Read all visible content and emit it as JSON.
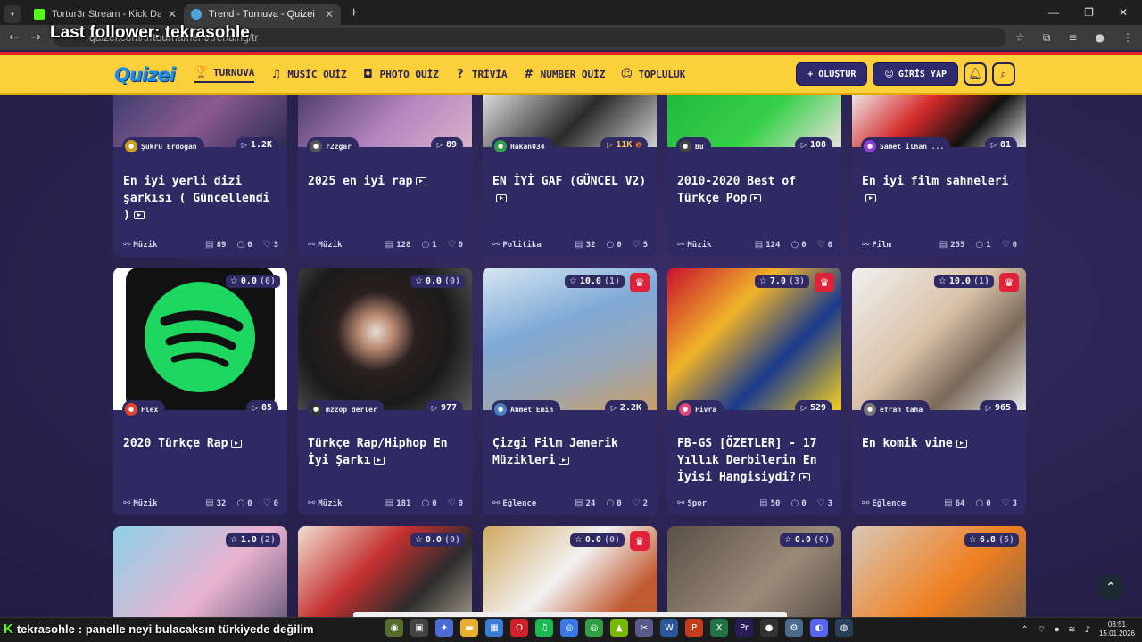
{
  "browser": {
    "tabs": [
      {
        "title": "Tortur3r Stream - Kick Dashbo...",
        "favicon_color": "#53fc18",
        "active": false
      },
      {
        "title": "Trend - Turnuva - Quizei",
        "favicon_color": "#4fa3e0",
        "active": true
      }
    ],
    "new_tab": "+",
    "url": "quizei.com/tr/tournament/trending/tr",
    "overlay_follower": "Last follower: tekrasohle"
  },
  "site": {
    "logo": "Quizei",
    "nav": [
      {
        "label": "TURNUVA",
        "icon": "trophy-icon",
        "glyph": "🏆",
        "active": true
      },
      {
        "label": "MUSİC QUİZ",
        "icon": "music-icon",
        "glyph": "♫",
        "active": false
      },
      {
        "label": "PHOTO QUİZ",
        "icon": "camera-icon",
        "glyph": "◘",
        "active": false
      },
      {
        "label": "TRİVİA",
        "icon": "speech-bubble-icon",
        "glyph": "?",
        "active": false
      },
      {
        "label": "NUMBER QUİZ",
        "icon": "hash-icon",
        "glyph": "#",
        "active": false
      },
      {
        "label": "TOPLULUK",
        "icon": "users-icon",
        "glyph": "☺",
        "active": false
      }
    ],
    "create_label": "+ OLUŞTUR",
    "login_label": "GİRİŞ YAP",
    "accent": "#fbd03b",
    "brand_red": "#e8202a",
    "card_bg": "#2f2a63"
  },
  "cards_top": [
    {
      "author": "Şükrü Erdoğan",
      "avatar_color": "#c9a020",
      "plays": "1.2K",
      "title": "En iyi yerli dizi şarkısı ( Güncellendi )",
      "category": "Müzik",
      "count": "89",
      "comments": "0",
      "likes": "3",
      "thumb": "linear-gradient(135deg,#3a3d6e,#8b5a8f 50%,#2c2c54)"
    },
    {
      "author": "r2zgar",
      "avatar_color": "#555",
      "plays": "89",
      "title": "2025 en iyi rap",
      "category": "Müzik",
      "count": "128",
      "comments": "1",
      "likes": "0",
      "thumb": "linear-gradient(135deg,#4a3a6a,#b585c0 55%,#d8b2c8)"
    },
    {
      "author": "Hakan034",
      "avatar_color": "#2fa04a",
      "plays": "11K",
      "hot": true,
      "title": "EN İYİ GAF (GÜNCEL V2)",
      "category": "Politika",
      "count": "32",
      "comments": "0",
      "likes": "5",
      "thumb": "linear-gradient(135deg,#e6e6e6,#2a2a2a 55%,#d0d0d0)"
    },
    {
      "author": "Bu",
      "avatar_color": "#444",
      "plays": "108",
      "title": "2010-2020 Best of Türkçe Pop",
      "category": "Müzik",
      "count": "124",
      "comments": "0",
      "likes": "0",
      "thumb": "linear-gradient(135deg,#1fb83a,#38d04a 55%,#e8e2dc)"
    },
    {
      "author": "Samet İlhan ...",
      "avatar_color": "#8c3fd1",
      "plays": "81",
      "title": "En iyi film sahneleri",
      "category": "Film",
      "count": "255",
      "comments": "1",
      "likes": "0",
      "thumb": "linear-gradient(135deg,#f2f2f2,#d42a2a 40%,#111 70%,#e0e0e0)"
    }
  ],
  "cards_mid": [
    {
      "rating": "0.0",
      "votes": "(0)",
      "crown": false,
      "author": "Flex",
      "avatar_color": "#e0452f",
      "plays": "85",
      "title": "2020 Türkçe Rap",
      "category": "Müzik",
      "count": "32",
      "comments": "0",
      "likes": "0",
      "thumb": "spotify"
    },
    {
      "rating": "0.0",
      "votes": "(0)",
      "crown": false,
      "author": "mzzop derler",
      "avatar_color": "#333",
      "plays": "977",
      "title": "Türkçe Rap/Hiphop En İyi Şarkı",
      "category": "Müzik",
      "count": "181",
      "comments": "0",
      "likes": "0",
      "thumb": "radial-gradient(circle at 45% 45%,#e6dcd2 0,#b88870 14%,#2a2020 32%,#1a1a1a 60%,#5a5a5a 100%)"
    },
    {
      "rating": "10.0",
      "votes": "(1)",
      "crown": true,
      "author": "Ahmet Emin",
      "avatar_color": "#4a7fc0",
      "plays": "2.2K",
      "title": "Çizgi Film Jenerik Müzikleri",
      "category": "Eğlence",
      "count": "24",
      "comments": "0",
      "likes": "2",
      "thumb": "linear-gradient(160deg,#d6e6f2,#7fa9d6 40%,#9aa6b4 70%,#c9a06a)"
    },
    {
      "rating": "7.0",
      "votes": "(3)",
      "crown": true,
      "author": "Fivra",
      "avatar_color": "#e0457a",
      "plays": "529",
      "title": "FB-GS [ÖZETLER] - 17 Yıllık Derbilerin En İyisi Hangisiydi?",
      "category": "Spor",
      "count": "50",
      "comments": "0",
      "likes": "3",
      "thumb": "linear-gradient(135deg,#c8102e,#f0b429 35%,#1b3a8c 65%,#f5d020)"
    },
    {
      "rating": "10.0",
      "votes": "(1)",
      "crown": true,
      "author": "efran taha",
      "avatar_color": "#777",
      "plays": "965",
      "title": "En komik vine",
      "category": "Eğlence",
      "count": "64",
      "comments": "0",
      "likes": "3",
      "thumb": "linear-gradient(135deg,#f0f0f0,#d9c1a8 45%,#7a6a5a 70%,#e8e8e8)"
    }
  ],
  "cards_bottom": [
    {
      "rating": "1.0",
      "votes": "(2)",
      "crown": false,
      "thumb": "linear-gradient(135deg,#8fd0e8,#e9b3d0 50%,#3a3a5a)"
    },
    {
      "rating": "0.0",
      "votes": "(0)",
      "crown": false,
      "thumb": "linear-gradient(135deg,#f0e0d0,#c43030 35%,#2c2c2c 60%,#e8d8c0)"
    },
    {
      "rating": "0.0",
      "votes": "(0)",
      "crown": true,
      "thumb": "linear-gradient(135deg,#d0a860,#f2f2f2 40%,#c05a30 70%)"
    },
    {
      "rating": "0.0",
      "votes": "(0)",
      "crown": false,
      "thumb": "linear-gradient(135deg,#5a5048,#9a8a78 50%,#3a3430)"
    },
    {
      "rating": "6.8",
      "votes": "(5)",
      "crown": false,
      "thumb": "linear-gradient(135deg,#d8c8b8,#f08020 50%,#5a5a5a)"
    }
  ],
  "overlay_chat": {
    "user": "tekrasohle",
    "message": ": panelle neyi bulacaksın türkiyede değilim"
  },
  "taskbar": {
    "time": "03:51",
    "date": "15.01.2026"
  }
}
